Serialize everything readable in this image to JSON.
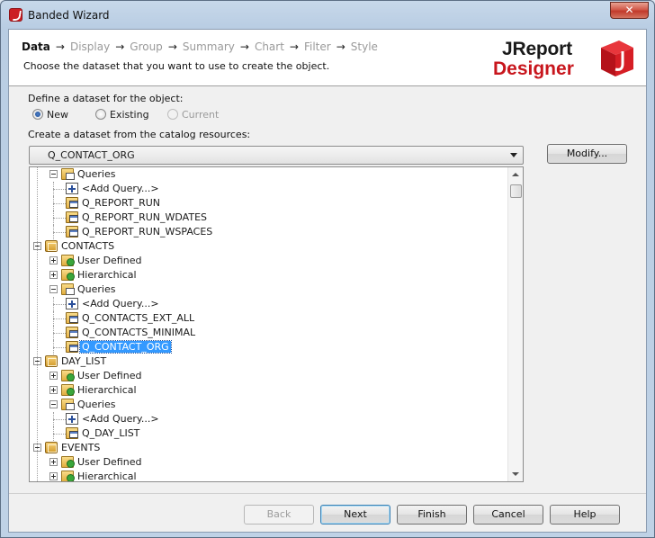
{
  "window": {
    "title": "Banded Wizard",
    "close_glyph": "✕"
  },
  "steps": [
    {
      "label": "Data",
      "active": true
    },
    {
      "label": "Display",
      "active": false
    },
    {
      "label": "Group",
      "active": false
    },
    {
      "label": "Summary",
      "active": false
    },
    {
      "label": "Chart",
      "active": false
    },
    {
      "label": "Filter",
      "active": false
    },
    {
      "label": "Style",
      "active": false
    }
  ],
  "step_arrow": "→",
  "subtitle": "Choose the dataset that you want to use to create the object.",
  "logo": {
    "line1": "JReport",
    "line2": "Designer",
    "brand_color": "#c8161d"
  },
  "define_label": "Define a dataset for the object:",
  "radios": [
    {
      "label": "New",
      "checked": true,
      "enabled": true
    },
    {
      "label": "Existing",
      "checked": false,
      "enabled": true
    },
    {
      "label": "Current",
      "checked": false,
      "enabled": false
    }
  ],
  "catalog_label": "Create a dataset from the catalog resources:",
  "combo_value": "Q_CONTACT_ORG",
  "modify_label": "Modify...",
  "tree": [
    {
      "label": "Queries",
      "icon": "queries-icon",
      "level": 1,
      "expander": "minus"
    },
    {
      "label": "<Add Query...>",
      "icon": "add-query-icon",
      "level": 2
    },
    {
      "label": "Q_REPORT_RUN",
      "icon": "query-icon",
      "level": 2
    },
    {
      "label": "Q_REPORT_RUN_WDATES",
      "icon": "query-icon",
      "level": 2
    },
    {
      "label": "Q_REPORT_RUN_WSPACES",
      "icon": "query-icon",
      "level": 2
    },
    {
      "label": "CONTACTS",
      "icon": "catalog-icon",
      "level": 0,
      "expander": "minus"
    },
    {
      "label": "User Defined",
      "icon": "folder-icon",
      "level": 1,
      "expander": "plus"
    },
    {
      "label": "Hierarchical",
      "icon": "folder-icon",
      "level": 1,
      "expander": "plus"
    },
    {
      "label": "Queries",
      "icon": "queries-icon",
      "level": 1,
      "expander": "minus"
    },
    {
      "label": "<Add Query...>",
      "icon": "add-query-icon",
      "level": 2
    },
    {
      "label": "Q_CONTACTS_EXT_ALL",
      "icon": "query-icon",
      "level": 2
    },
    {
      "label": "Q_CONTACTS_MINIMAL",
      "icon": "query-icon",
      "level": 2
    },
    {
      "label": "Q_CONTACT_ORG",
      "icon": "query-icon",
      "level": 2,
      "selected": true
    },
    {
      "label": "DAY_LIST",
      "icon": "catalog-icon",
      "level": 0,
      "expander": "minus"
    },
    {
      "label": "User Defined",
      "icon": "folder-icon",
      "level": 1,
      "expander": "plus"
    },
    {
      "label": "Hierarchical",
      "icon": "folder-icon",
      "level": 1,
      "expander": "plus"
    },
    {
      "label": "Queries",
      "icon": "queries-icon",
      "level": 1,
      "expander": "minus"
    },
    {
      "label": "<Add Query...>",
      "icon": "add-query-icon",
      "level": 2
    },
    {
      "label": "Q_DAY_LIST",
      "icon": "query-icon",
      "level": 2
    },
    {
      "label": "EVENTS",
      "icon": "catalog-icon",
      "level": 0,
      "expander": "minus"
    },
    {
      "label": "User Defined",
      "icon": "folder-icon",
      "level": 1,
      "expander": "plus"
    },
    {
      "label": "Hierarchical",
      "icon": "folder-icon",
      "level": 1,
      "expander": "plus"
    }
  ],
  "buttons": {
    "back": "Back",
    "next": "Next",
    "finish": "Finish",
    "cancel": "Cancel",
    "help": "Help"
  }
}
